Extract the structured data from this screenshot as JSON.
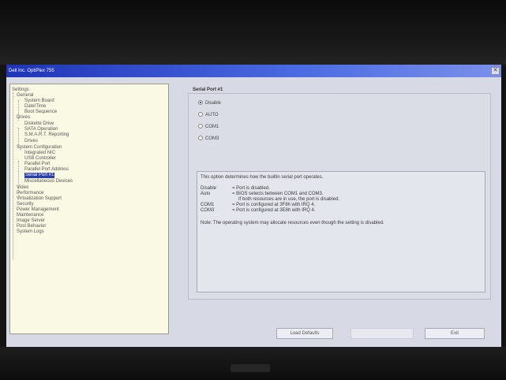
{
  "window": {
    "title": "Dell Inc. OptiPlex 755"
  },
  "tree": {
    "items": [
      "Settings",
      "General",
      "System Board",
      "Date/Time",
      "Boot Sequence",
      "Drives",
      "Diskette Drive",
      "SATA Operation",
      "S.M.A.R.T. Reporting",
      "Drives",
      "System Configuration",
      "Integrated NIC",
      "USB Controller",
      "Parallel Port",
      "Parallel Port Address",
      "Serial Port #1",
      "Miscellaneous Devices",
      "Video",
      "Performance",
      "Virtualization Support",
      "Security",
      "Power Management",
      "Maintenance",
      "Image Server",
      "Post Behavior",
      "System Logs"
    ]
  },
  "serial_port": {
    "title": "Serial Port #1",
    "options": [
      "Disable",
      "AUTO",
      "COM1",
      "COM3"
    ],
    "selected": "Disable"
  },
  "description": {
    "intro": "This option determines how the builtin serial port operates.",
    "rows": [
      {
        "key": "Disable",
        "text": "= Port is disabled."
      },
      {
        "key": "Auto",
        "text": "= BIOS selects between COM1 and COM3."
      },
      {
        "key": "",
        "text": "If both resources are in use, the port is disabled."
      },
      {
        "key": "COM1",
        "text": "= Port is configured at 3F8h with IRQ 4."
      },
      {
        "key": "COM3",
        "text": "= Port is configured at 3E8h with IRQ 4."
      }
    ],
    "note": "Note: The operating system may allocate resources even though the setting is disabled."
  },
  "buttons": {
    "load_defaults": "Load Defaults",
    "apply": "",
    "exit": "Exit"
  }
}
